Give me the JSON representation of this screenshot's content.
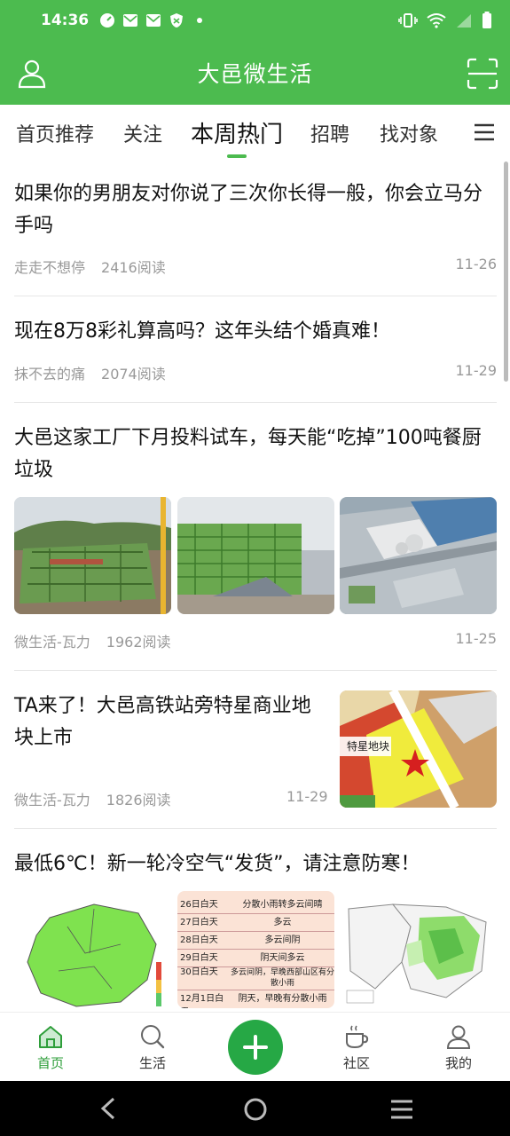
{
  "status_bar": {
    "time": "14:36"
  },
  "app": {
    "title": "大邑微生活"
  },
  "tabs": [
    {
      "label": "首页推荐"
    },
    {
      "label": "关注"
    },
    {
      "label": "本周热门"
    },
    {
      "label": "招聘"
    },
    {
      "label": "找对象"
    }
  ],
  "articles": [
    {
      "title": "如果你的男朋友对你说了三次你长得一般，你会立马分手吗",
      "author": "走走不想停",
      "reads": "2416阅读",
      "date": "11-26"
    },
    {
      "title": "现在8万8彩礼算高吗？这年头结个婚真难！",
      "author": "抹不去的痛",
      "reads": "2074阅读",
      "date": "11-29"
    },
    {
      "title": "大邑这家工厂下月投料试车，每天能“吃掉”100吨餐厨垃圾",
      "author": "微生活-瓦力",
      "reads": "1962阅读",
      "date": "11-25"
    },
    {
      "title": "TA来了！大邑高铁站旁特星商业地块上市",
      "author": "微生活-瓦力",
      "reads": "1826阅读",
      "date": "11-29",
      "map_label": "特星地块"
    },
    {
      "title": "最低6℃！新一轮冷空气“发货”，请注意防寒！",
      "forecast": [
        {
          "day": "26日白天",
          "weather": "分散小雨转多云间晴"
        },
        {
          "day": "27日白天",
          "weather": "多云"
        },
        {
          "day": "28日白天",
          "weather": "多云间阴"
        },
        {
          "day": "29日白天",
          "weather": "阴天间多云"
        },
        {
          "day": "30日白天",
          "weather": "多云间阴，早晚西部山区有分散小雨"
        },
        {
          "day": "12月1日白天",
          "weather": "阴天，早晚有分散小雨"
        }
      ]
    }
  ],
  "bottom_nav": [
    {
      "label": "首页"
    },
    {
      "label": "生活"
    },
    {
      "label": "社区"
    },
    {
      "label": "我的"
    }
  ],
  "colors": {
    "brand": "#4CBB4F",
    "fab": "#26A845",
    "active_nav": "#2E9E3A"
  }
}
